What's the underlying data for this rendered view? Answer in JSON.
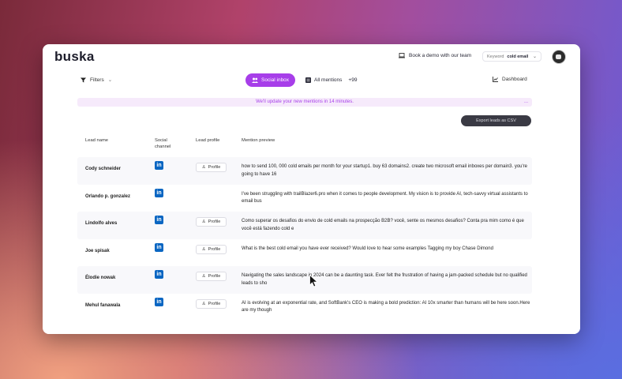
{
  "app": {
    "logo": "buska",
    "demo_label": "Book a demo with our team",
    "keyword_label": "Keyword",
    "keyword_value": "cold email"
  },
  "toolbar": {
    "filters_label": "Filters",
    "social_inbox_label": "Social inbox",
    "all_mentions_label": "All mentions",
    "all_mentions_count": "+99",
    "dashboard_label": "Dashboard"
  },
  "banner": {
    "text": "We'll update your new mentions in 14 minutes.",
    "more": "..."
  },
  "export_label": "Export leads as CSV",
  "table": {
    "headers": [
      "Lead name",
      "Social channel",
      "Lead profile",
      "Mention preview"
    ],
    "profile_label": "Profile",
    "rows": [
      {
        "name": "Cody schneider",
        "preview": "how to send 100, 000 cold emails per month for your startup1. buy 63 domains2. create two microsoft email inboxes per domain3. you're going to have 16"
      },
      {
        "name": "Orlando p. gonzalez",
        "preview": "I've been struggling with trailBlazer6.pro when it comes to people development. My vision is to provide AI, tech-savvy virtual assistants to email bus"
      },
      {
        "name": "Lindolfo alves",
        "preview": "Como superar os desafios do envio de cold emails na prospecção B2B? você, sente os mesmos desafios? Conta pra mim como é que você está fazendo cold e"
      },
      {
        "name": "Joe spisak",
        "preview": "What is the best cold email you have ever received? Would love to hear some examples Tagging my boy Chase Dimond"
      },
      {
        "name": "Élodie nowak",
        "preview": "Navigating the sales landscape in 2024 can be a daunting task. Ever felt the frustration of having a jam-packed schedule but no qualified leads to sho"
      },
      {
        "name": "Mehul fanawala",
        "preview": "AI is evolving at an exponential rate, and SoftBank's CEO is making a bold prediction: AI 10x smarter than humans will be here soon.Here are my though"
      }
    ]
  },
  "colors": {
    "accent": "#a73ee9",
    "linkedin": "#0a66c2",
    "dark_button": "#3a3a44"
  },
  "icons": {
    "linkedin": "linkedin-icon",
    "profile": "user-icon",
    "filters": "filter-icon",
    "dashboard": "chart-icon",
    "demo": "laptop-icon"
  }
}
